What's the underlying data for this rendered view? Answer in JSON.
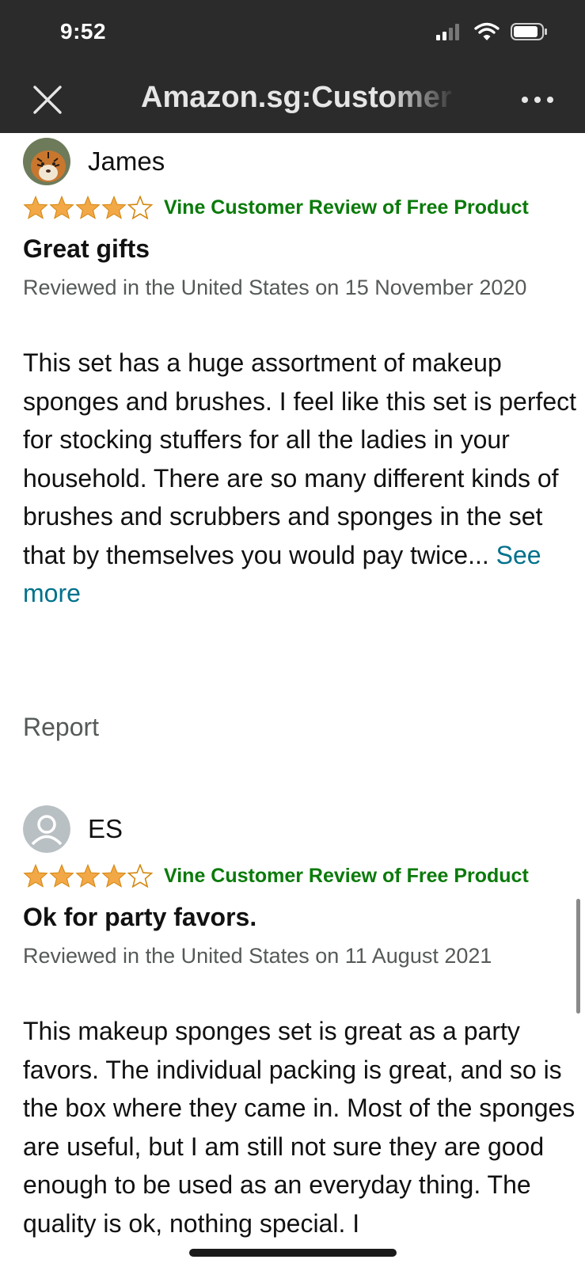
{
  "status_bar": {
    "time": "9:52"
  },
  "nav": {
    "title": "Amazon.sg:Customer Reviews"
  },
  "reviews": [
    {
      "reviewer": "James",
      "rating": 4,
      "vine_badge": "Vine Customer Review of Free Product",
      "title": "Great gifts",
      "date": "Reviewed in the United States on 15 November 2020",
      "body": "This set has a huge assortment of makeup sponges and brushes. I feel like this set is perfect for stocking stuffers for all the ladies in your household. There are so many different kinds of brushes and scrubbers and sponges in the set that by themselves you would pay twice...",
      "see_more": "See more",
      "report": "Report"
    },
    {
      "reviewer": "ES",
      "rating": 4,
      "vine_badge": "Vine Customer Review of Free Product",
      "title": "Ok for party favors.",
      "date": "Reviewed in the United States on 11 August 2021",
      "body": "This makeup sponges set is great as a party favors. The individual packing is great, and so is the box where they came in. Most of the sponges are useful, but I am still not sure they are good enough to be used as an everyday thing. The quality is ok, nothing special. I"
    }
  ],
  "colors": {
    "star": "#f3a847",
    "vine_green": "#0a7a0a",
    "link": "#00718c",
    "dark_bar": "#2b2b2b"
  }
}
